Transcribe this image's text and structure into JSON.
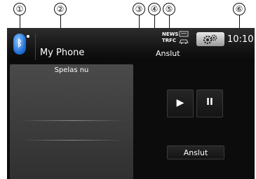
{
  "callouts": [
    "①",
    "②",
    "③",
    "④",
    "⑤",
    "⑥"
  ],
  "header": {
    "bluetooth_icon": "bluetooth-icon",
    "device_name": "My Phone",
    "connection_status": "Anslut",
    "news_label": "NEWS",
    "trfc_label": "TRFC",
    "clock": "10:10"
  },
  "now_playing": {
    "title": "Spelas nu"
  },
  "controls": {
    "play_glyph": "▶",
    "pause_glyph": "II",
    "connect_label": "Anslut"
  },
  "colors": {
    "screen_bg": "#0c0c0c",
    "bluetooth_blue": "#1f6fd6",
    "panel_bg": "#3d3d3d",
    "text": "#ffffff"
  }
}
